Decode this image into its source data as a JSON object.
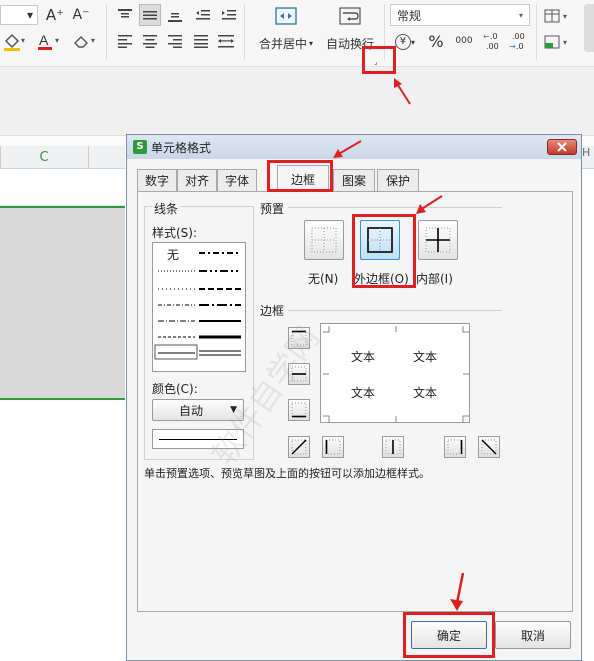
{
  "ribbon": {
    "font_grow": "A⁺",
    "font_shrink": "A⁻",
    "font_color_letter": "A",
    "merge_label": "合并居中",
    "wrap_label": "自动换行",
    "number_format_value": "常规",
    "yen": "¥",
    "percent": "%",
    "thousands": "000",
    "inc_decimal": "+.0 .00",
    "dec_decimal": "←.0 .00"
  },
  "sheet": {
    "column_c": "C"
  },
  "dialog": {
    "title": "单元格格式",
    "tabs": [
      "数字",
      "对齐",
      "字体",
      "边框",
      "图案",
      "保护"
    ],
    "line_group": "线条",
    "style_label": "样式(S):",
    "style_none": "无",
    "color_label": "颜色(C):",
    "color_value": "自动",
    "preset_group": "预置",
    "preset_none": "无(N)",
    "preset_outline": "外边框(O)",
    "preset_inside": "内部(I)",
    "border_group": "边框",
    "preview_texts": [
      "文本",
      "文本",
      "文本",
      "文本"
    ],
    "hint": "单击预置选项、预览草图及上面的按钮可以添加边框样式。",
    "ok": "确定",
    "cancel": "取消"
  },
  "watermark": "软件自学网"
}
